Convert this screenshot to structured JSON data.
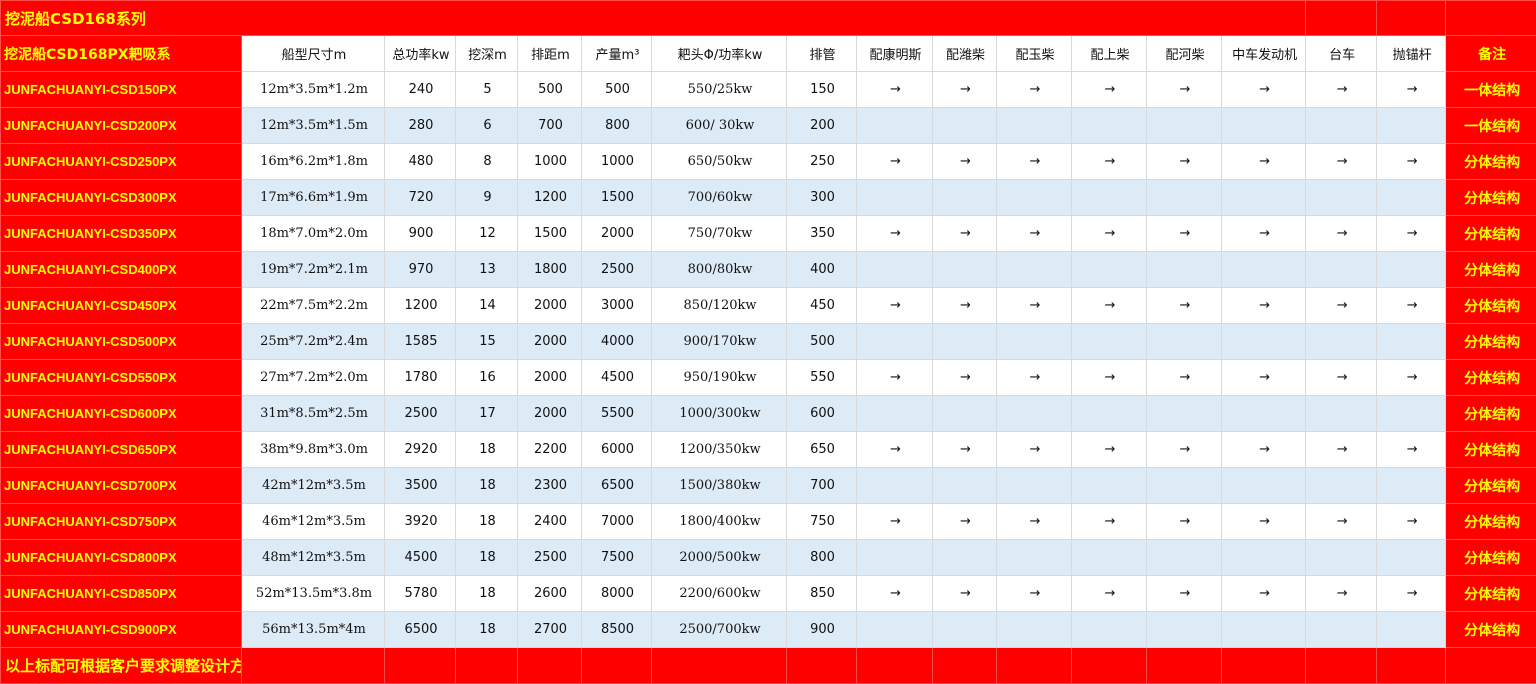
{
  "sheet": {
    "title": "挖泥船CSD168系列",
    "series_label": "挖泥船CSD168PX耙吸系",
    "headers": [
      "船型尺寸m",
      "总功率kw",
      "挖深m",
      "排距m",
      "产量m³",
      "耙头Φ/功率kw",
      "排管",
      "配康明斯",
      "配潍柴",
      "配玉柴",
      "配上柴",
      "配河柴",
      "中车发动机",
      "台车",
      "抛锚杆"
    ],
    "remark_header": "备注",
    "arrow_symbol": "→",
    "rows": [
      {
        "model": "JUNFACHUANYI-CSD150PX",
        "size": "12m*3.5m*1.2m",
        "power": "240",
        "depth": "5",
        "distance": "500",
        "output": "500",
        "cutter": "550/25kw",
        "pipe": "150",
        "remark": "一体结构",
        "arrows": true
      },
      {
        "model": "JUNFACHUANYI-CSD200PX",
        "size": "12m*3.5m*1.5m",
        "power": "280",
        "depth": "6",
        "distance": "700",
        "output": "800",
        "cutter": "600/ 30kw",
        "pipe": "200",
        "remark": "一体结构",
        "arrows": false
      },
      {
        "model": "JUNFACHUANYI-CSD250PX",
        "size": "16m*6.2m*1.8m",
        "power": "480",
        "depth": "8",
        "distance": "1000",
        "output": "1000",
        "cutter": "650/50kw",
        "pipe": "250",
        "remark": "分体结构",
        "arrows": true
      },
      {
        "model": "JUNFACHUANYI-CSD300PX",
        "size": "17m*6.6m*1.9m",
        "power": "720",
        "depth": "9",
        "distance": "1200",
        "output": "1500",
        "cutter": "700/60kw",
        "pipe": "300",
        "remark": "分体结构",
        "arrows": false
      },
      {
        "model": "JUNFACHUANYI-CSD350PX",
        "size": "18m*7.0m*2.0m",
        "power": "900",
        "depth": "12",
        "distance": "1500",
        "output": "2000",
        "cutter": "750/70kw",
        "pipe": "350",
        "remark": "分体结构",
        "arrows": true
      },
      {
        "model": "JUNFACHUANYI-CSD400PX",
        "size": "19m*7.2m*2.1m",
        "power": "970",
        "depth": "13",
        "distance": "1800",
        "output": "2500",
        "cutter": "800/80kw",
        "pipe": "400",
        "remark": "分体结构",
        "arrows": false
      },
      {
        "model": "JUNFACHUANYI-CSD450PX",
        "size": "22m*7.5m*2.2m",
        "power": "1200",
        "depth": "14",
        "distance": "2000",
        "output": "3000",
        "cutter": "850/120kw",
        "pipe": "450",
        "remark": "分体结构",
        "arrows": true
      },
      {
        "model": "JUNFACHUANYI-CSD500PX",
        "size": "25m*7.2m*2.4m",
        "power": "1585",
        "depth": "15",
        "distance": "2000",
        "output": "4000",
        "cutter": "900/170kw",
        "pipe": "500",
        "remark": "分体结构",
        "arrows": false
      },
      {
        "model": "JUNFACHUANYI-CSD550PX",
        "size": "27m*7.2m*2.0m",
        "power": "1780",
        "depth": "16",
        "distance": "2000",
        "output": "4500",
        "cutter": "950/190kw",
        "pipe": "550",
        "remark": "分体结构",
        "arrows": true
      },
      {
        "model": "JUNFACHUANYI-CSD600PX",
        "size": "31m*8.5m*2.5m",
        "power": "2500",
        "depth": "17",
        "distance": "2000",
        "output": "5500",
        "cutter": "1000/300kw",
        "pipe": "600",
        "remark": "分体结构",
        "arrows": false
      },
      {
        "model": "JUNFACHUANYI-CSD650PX",
        "size": "38m*9.8m*3.0m",
        "power": "2920",
        "depth": "18",
        "distance": "2200",
        "output": "6000",
        "cutter": "1200/350kw",
        "pipe": "650",
        "remark": "分体结构",
        "arrows": true
      },
      {
        "model": "JUNFACHUANYI-CSD700PX",
        "size": "42m*12m*3.5m",
        "power": "3500",
        "depth": "18",
        "distance": "2300",
        "output": "6500",
        "cutter": "1500/380kw",
        "pipe": "700",
        "remark": "分体结构",
        "arrows": false
      },
      {
        "model": "JUNFACHUANYI-CSD750PX",
        "size": "46m*12m*3.5m",
        "power": "3920",
        "depth": "18",
        "distance": "2400",
        "output": "7000",
        "cutter": "1800/400kw",
        "pipe": "750",
        "remark": "分体结构",
        "arrows": true
      },
      {
        "model": "JUNFACHUANYI-CSD800PX",
        "size": "48m*12m*3.5m",
        "power": "4500",
        "depth": "18",
        "distance": "2500",
        "output": "7500",
        "cutter": "2000/500kw",
        "pipe": "800",
        "remark": "分体结构",
        "arrows": false
      },
      {
        "model": "JUNFACHUANYI-CSD850PX",
        "size": "52m*13.5m*3.8m",
        "power": "5780",
        "depth": "18",
        "distance": "2600",
        "output": "8000",
        "cutter": "2200/600kw",
        "pipe": "850",
        "remark": "分体结构",
        "arrows": true
      },
      {
        "model": "JUNFACHUANYI-CSD900PX",
        "size": "56m*13.5m*4m",
        "power": "6500",
        "depth": "18",
        "distance": "2700",
        "output": "8500",
        "cutter": "2500/700kw",
        "pipe": "900",
        "remark": "分体结构",
        "arrows": false
      }
    ],
    "footer": "以上标配可根据客户要求调整设计方案",
    "colors": {
      "red": "#ff0000",
      "yellow": "#ffff00",
      "band": "#ddebf7",
      "white": "#ffffff"
    }
  }
}
